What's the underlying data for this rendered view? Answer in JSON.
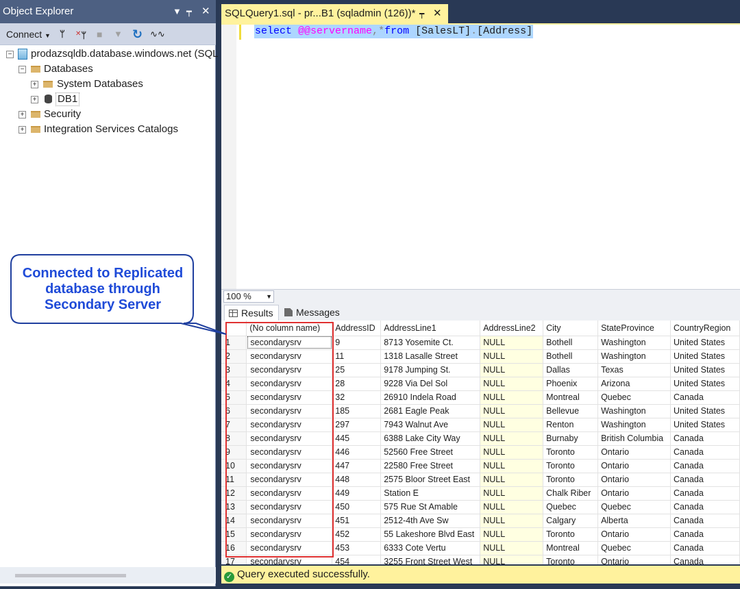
{
  "object_explorer": {
    "title": "Object Explorer",
    "title_icons": [
      "chevron-down-icon",
      "pin-icon",
      "close-icon"
    ],
    "toolbar": {
      "connect_label": "Connect",
      "icons": [
        "connect-plug-icon",
        "disconnect-icon",
        "stop-icon",
        "filter-icon",
        "refresh-icon",
        "activity-monitor-icon"
      ]
    },
    "tree": {
      "server": "prodazsqldb.database.windows.net (SQL",
      "databases": "Databases",
      "system_databases": "System Databases",
      "db1": "DB1",
      "security": "Security",
      "integration": "Integration Services Catalogs"
    }
  },
  "document_tab": {
    "title": "SQLQuery1.sql - pr...B1 (sqladmin (126))*"
  },
  "editor": {
    "sql": {
      "kw1": "select",
      "fn": "@@servername",
      "comma": ",",
      "star": "*",
      "kw2": "from",
      "schema": "[SalesLT]",
      "dot": ".",
      "table": "[Address]"
    }
  },
  "zoom": "100 %",
  "results_tabs": {
    "results": "Results",
    "messages": "Messages"
  },
  "grid": {
    "columns": [
      "(No column name)",
      "AddressID",
      "AddressLine1",
      "AddressLine2",
      "City",
      "StateProvince",
      "CountryRegion"
    ],
    "rows": [
      [
        "1",
        "secondarysrv",
        "9",
        "8713 Yosemite Ct.",
        "NULL",
        "Bothell",
        "Washington",
        "United States"
      ],
      [
        "2",
        "secondarysrv",
        "11",
        "1318 Lasalle Street",
        "NULL",
        "Bothell",
        "Washington",
        "United States"
      ],
      [
        "3",
        "secondarysrv",
        "25",
        "9178 Jumping St.",
        "NULL",
        "Dallas",
        "Texas",
        "United States"
      ],
      [
        "4",
        "secondarysrv",
        "28",
        "9228 Via Del Sol",
        "NULL",
        "Phoenix",
        "Arizona",
        "United States"
      ],
      [
        "5",
        "secondarysrv",
        "32",
        "26910 Indela Road",
        "NULL",
        "Montreal",
        "Quebec",
        "Canada"
      ],
      [
        "6",
        "secondarysrv",
        "185",
        "2681 Eagle Peak",
        "NULL",
        "Bellevue",
        "Washington",
        "United States"
      ],
      [
        "7",
        "secondarysrv",
        "297",
        "7943 Walnut Ave",
        "NULL",
        "Renton",
        "Washington",
        "United States"
      ],
      [
        "8",
        "secondarysrv",
        "445",
        "6388 Lake City Way",
        "NULL",
        "Burnaby",
        "British Columbia",
        "Canada"
      ],
      [
        "9",
        "secondarysrv",
        "446",
        "52560 Free Street",
        "NULL",
        "Toronto",
        "Ontario",
        "Canada"
      ],
      [
        "10",
        "secondarysrv",
        "447",
        "22580 Free Street",
        "NULL",
        "Toronto",
        "Ontario",
        "Canada"
      ],
      [
        "11",
        "secondarysrv",
        "448",
        "2575 Bloor Street East",
        "NULL",
        "Toronto",
        "Ontario",
        "Canada"
      ],
      [
        "12",
        "secondarysrv",
        "449",
        "Station E",
        "NULL",
        "Chalk Riber",
        "Ontario",
        "Canada"
      ],
      [
        "13",
        "secondarysrv",
        "450",
        "575 Rue St Amable",
        "NULL",
        "Quebec",
        "Quebec",
        "Canada"
      ],
      [
        "14",
        "secondarysrv",
        "451",
        "2512-4th Ave Sw",
        "NULL",
        "Calgary",
        "Alberta",
        "Canada"
      ],
      [
        "15",
        "secondarysrv",
        "452",
        "55 Lakeshore Blvd East",
        "NULL",
        "Toronto",
        "Ontario",
        "Canada"
      ],
      [
        "16",
        "secondarysrv",
        "453",
        "6333 Cote Vertu",
        "NULL",
        "Montreal",
        "Quebec",
        "Canada"
      ],
      [
        "17",
        "secondarysrv",
        "454",
        "3255 Front Street West",
        "NULL",
        "Toronto",
        "Ontario",
        "Canada"
      ]
    ]
  },
  "status": "Query executed successfully.",
  "callout": "Connected to Replicated database through Secondary Server",
  "colors": {
    "tab_accent": "#fff29d",
    "title_bar": "#4d6082",
    "callout_text": "#1f4bd8",
    "highlight_box": "#e03131",
    "null_cell": "#ffffe1"
  }
}
